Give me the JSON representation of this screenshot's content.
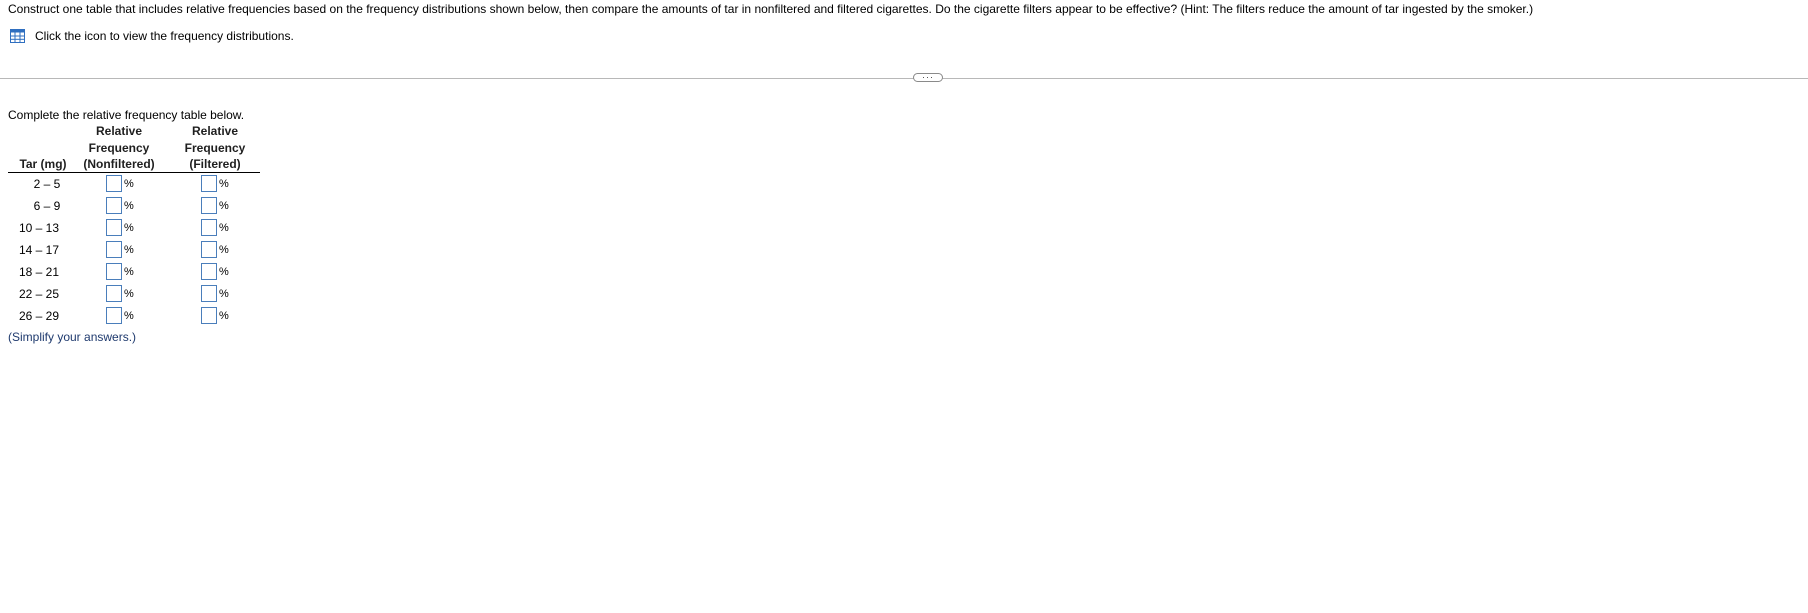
{
  "question": {
    "text": "Construct one table that includes relative frequencies based on the frequency distributions shown below, then compare the amounts of tar in nonfiltered and filtered cigarettes. Do the cigarette filters appear to be effective? (Hint: The filters reduce the amount of tar ingested by the smoker.)"
  },
  "icon_link": {
    "icon": "table-grid-icon",
    "text": "Click the icon to view the frequency distributions."
  },
  "expand_button": {
    "label": "···"
  },
  "instruction": "Complete the relative frequency table below.",
  "table": {
    "headers": {
      "col1": [
        "",
        "",
        "Tar (mg)"
      ],
      "col2": [
        "Relative",
        "Frequency",
        "(Nonfiltered)"
      ],
      "col3": [
        "Relative",
        "Frequency",
        "(Filtered)"
      ]
    },
    "unit_symbol": "%",
    "rows": [
      {
        "label": "2 – 5",
        "nonfiltered": "",
        "filtered": ""
      },
      {
        "label": "6 – 9",
        "nonfiltered": "",
        "filtered": ""
      },
      {
        "label": "10 – 13",
        "nonfiltered": "",
        "filtered": ""
      },
      {
        "label": "14 – 17",
        "nonfiltered": "",
        "filtered": ""
      },
      {
        "label": "18 – 21",
        "nonfiltered": "",
        "filtered": ""
      },
      {
        "label": "22 – 25",
        "nonfiltered": "",
        "filtered": ""
      },
      {
        "label": "26 – 29",
        "nonfiltered": "",
        "filtered": ""
      }
    ]
  },
  "footnote": "(Simplify your answers.)",
  "colors": {
    "icon_blue": "#2f6fc0",
    "input_border": "#4a7ebb",
    "footnote_text": "#1f3a6e",
    "divider": "#b8b8b8"
  }
}
